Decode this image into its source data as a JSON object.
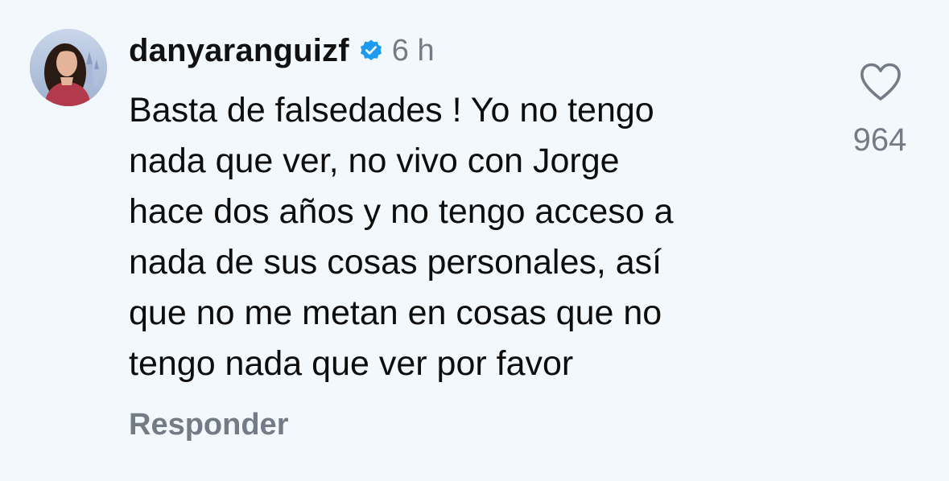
{
  "comment": {
    "username": "danyaranguizf",
    "verified_icon": "verified-badge-icon",
    "timestamp": "6 h",
    "text_lines": [
      "Basta de falsedades ! Yo no tengo",
      "nada que ver, no vivo con Jorge",
      "hace dos años y no tengo acceso a",
      "nada de sus cosas personales, así",
      "que no me metan en cosas que no",
      "tengo nada que ver por favor"
    ],
    "reply_label": "Responder",
    "like_icon": "heart-outline-icon",
    "like_count": "964"
  },
  "colors": {
    "background": "#f2f8fc",
    "text": "#0d0d0d",
    "muted": "#737b86",
    "verified": "#1d9bf0"
  }
}
